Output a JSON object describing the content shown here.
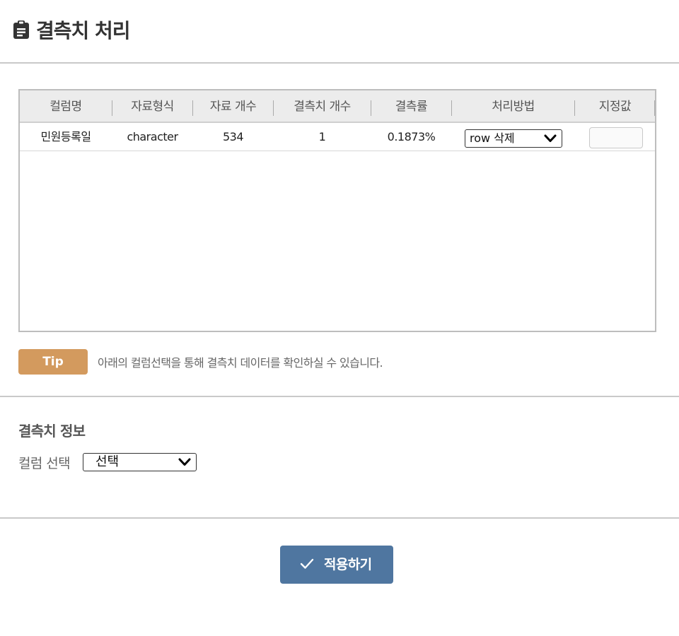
{
  "header": {
    "title": "결측치 처리",
    "icon": "clipboard-icon"
  },
  "grid": {
    "columns": [
      "컬럼명",
      "자료형식",
      "자료 개수",
      "결측치 개수",
      "결측률",
      "처리방법",
      "지정값"
    ],
    "rows": [
      {
        "column_name": "민원등록일",
        "data_type": "character",
        "count": "534",
        "missing_count": "1",
        "missing_rate": "0.1873%",
        "method": "row 삭제",
        "value": ""
      }
    ]
  },
  "tip": {
    "badge": "Tip",
    "text": "아래의 컬럼선택을 통해 결측치 데이터를 확인하실 수 있습니다."
  },
  "missing_info": {
    "title": "결측치 정보",
    "select_label": "컬럼 선택",
    "select_value": "선택"
  },
  "actions": {
    "apply_label": "적용하기"
  },
  "colors": {
    "tip_badge": "#d39a5e",
    "apply_button": "#4f76a0",
    "header_bg": "#ececec"
  }
}
